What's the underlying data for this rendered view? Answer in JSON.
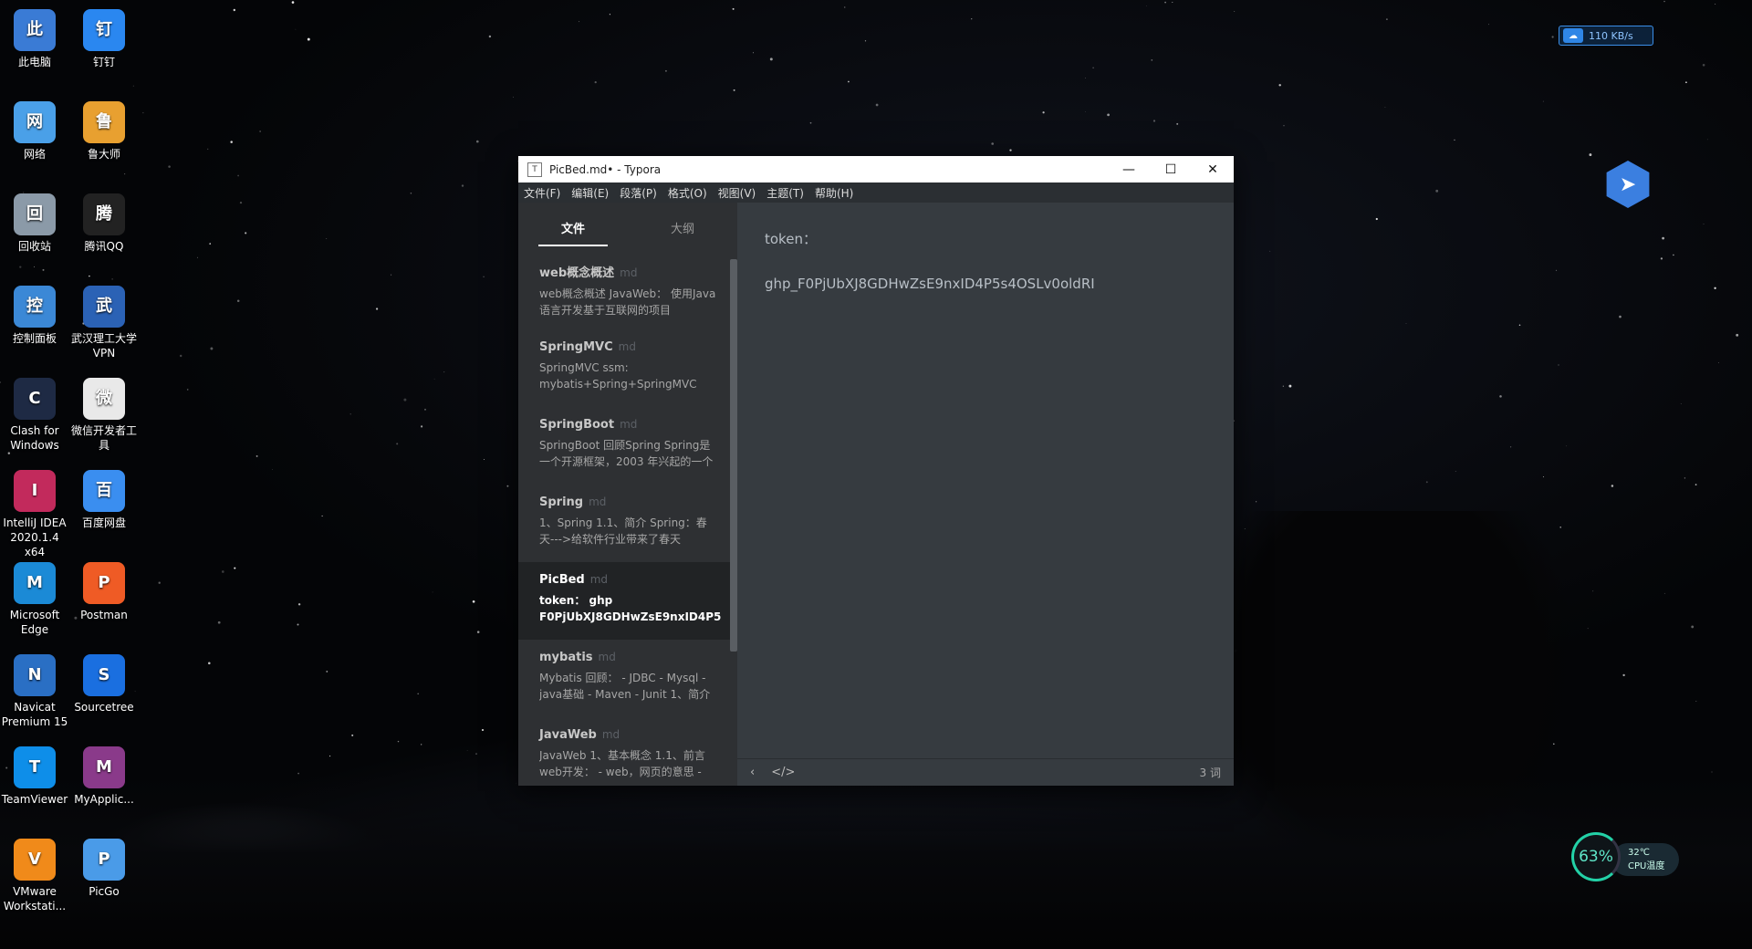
{
  "desktop_icons": [
    {
      "label": "此电脑",
      "icon": "computer-icon",
      "color": "#3a7bd5"
    },
    {
      "label": "钉钉",
      "icon": "dingtalk-icon",
      "color": "#2a87f0"
    },
    {
      "label": "网络",
      "icon": "network-icon",
      "color": "#4aa0e8"
    },
    {
      "label": "鲁大师",
      "icon": "ludashi-icon",
      "color": "#e8a030"
    },
    {
      "label": "回收站",
      "icon": "recycle-bin-icon",
      "color": "#8b9aa8"
    },
    {
      "label": "腾讯QQ",
      "icon": "qq-icon",
      "color": "#222222"
    },
    {
      "label": "控制面板",
      "icon": "control-panel-icon",
      "color": "#3b88d6"
    },
    {
      "label": "武汉理工大学VPN",
      "icon": "vpn-icon",
      "color": "#2b62b5"
    },
    {
      "label": "Clash for Windows",
      "icon": "clash-icon",
      "color": "#1e2a44"
    },
    {
      "label": "微信开发者工具",
      "icon": "wechat-devtools-icon",
      "color": "#e9e9e9"
    },
    {
      "label": "IntelliJ IDEA 2020.1.4 x64",
      "icon": "intellij-icon",
      "color": "#c22a5c"
    },
    {
      "label": "百度网盘",
      "icon": "baidu-netdisk-icon",
      "color": "#3a8ef0"
    },
    {
      "label": "Microsoft Edge",
      "icon": "edge-icon",
      "color": "#1b8ad6"
    },
    {
      "label": "Postman",
      "icon": "postman-icon",
      "color": "#ef5b25"
    },
    {
      "label": "Navicat Premium 15",
      "icon": "navicat-icon",
      "color": "#2a6fc4"
    },
    {
      "label": "Sourcetree",
      "icon": "sourcetree-icon",
      "color": "#1a6fe0"
    },
    {
      "label": "TeamViewer",
      "icon": "teamviewer-icon",
      "color": "#0e8ee9"
    },
    {
      "label": "MyApplic...",
      "icon": "winrar-icon",
      "color": "#8a3a8a"
    },
    {
      "label": "VMware Workstati...",
      "icon": "vmware-icon",
      "color": "#f08a1a"
    },
    {
      "label": "PicGo",
      "icon": "picgo-icon",
      "color": "#4a9be8"
    }
  ],
  "tray": {
    "net_speed": "110 KB/s",
    "cpu_percent": "63%",
    "cpu_temp": "32℃",
    "cpu_label": "CPU温度"
  },
  "window": {
    "title": "PicBed.md• - Typora",
    "menu": [
      "文件(F)",
      "编辑(E)",
      "段落(P)",
      "格式(O)",
      "视图(V)",
      "主题(T)",
      "帮助(H)"
    ],
    "sidebar_tabs": {
      "files": "文件",
      "outline": "大纲"
    },
    "files": [
      {
        "name": "web概念概述",
        "ext": "md",
        "excerpt": "web概念概述 JavaWeb： 使用Java语言开发基于互联网的项目",
        "active": false
      },
      {
        "name": "SpringMVC",
        "ext": "md",
        "excerpt": "SpringMVC ssm: mybatis+Spring+SpringMVC MVC",
        "active": false
      },
      {
        "name": "SpringBoot",
        "ext": "md",
        "excerpt": "SpringBoot 回顾Spring Spring是一个开源框架，2003 年兴起的一个",
        "active": false
      },
      {
        "name": "Spring",
        "ext": "md",
        "excerpt": "1、Spring 1.1、简介 Spring：春天--->给软件行业带来了春天",
        "active": false
      },
      {
        "name": "PicBed",
        "ext": "md",
        "excerpt": "token： ghp F0PjUbXJ8GDHwZsE9nxID4P5...",
        "active": true
      },
      {
        "name": "mybatis",
        "ext": "md",
        "excerpt": "Mybatis 回顾： - JDBC - Mysql - java基础 - Maven - Junit 1、简介",
        "active": false
      },
      {
        "name": "JavaWeb",
        "ext": "md",
        "excerpt": "JavaWeb 1、基本概念 1.1、前言 web开发： - web，网页的意思 -",
        "active": false
      }
    ],
    "content": [
      "token：",
      "ghp_F0PjUbXJ8GDHwZsE9nxID4P5s4OSLv0oldRI"
    ],
    "word_count": "3 词"
  }
}
